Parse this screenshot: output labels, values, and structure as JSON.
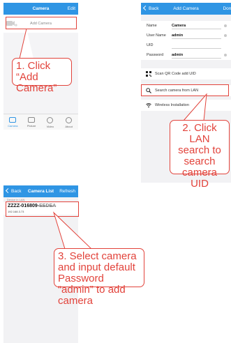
{
  "panel1": {
    "title": "Camera",
    "edit_label": "Edit",
    "add_camera_label": "Add Camera",
    "callout": "1. Click “Add Camera”",
    "tabs": [
      {
        "label": "Camera",
        "icon": "camera-icon"
      },
      {
        "label": "Picture",
        "icon": "picture-icon"
      },
      {
        "label": "Video",
        "icon": "video-icon"
      },
      {
        "label": "About",
        "icon": "about-icon"
      }
    ]
  },
  "panel2": {
    "back_label": "Back",
    "title": "Add Camera",
    "done_label": "Done",
    "fields": [
      {
        "label": "Name",
        "value": "Camera"
      },
      {
        "label": "User Name",
        "value": "admin"
      },
      {
        "label": "UID",
        "value": ""
      },
      {
        "label": "Password",
        "value": "admin"
      }
    ],
    "scan_qr_label": "Scan QR Code add UID",
    "search_lan_label": "Search camera from LAN",
    "wireless_label": "Wireless Installation",
    "callout": "2. Click LAN search to search camera UID"
  },
  "panel3": {
    "back_label": "Back",
    "title": "Camera List",
    "refresh_label": "Refresh",
    "section_label": "Device in LAN",
    "camera_uid": "ZZZZ-016809-",
    "camera_uid_hidden": "EEDEA",
    "camera_ip": "192.168.3.73",
    "callout": "3. Select camera and input default Password “admin” to add camera"
  },
  "colors": {
    "accent": "#2f95e4",
    "callout": "#e2433b"
  }
}
